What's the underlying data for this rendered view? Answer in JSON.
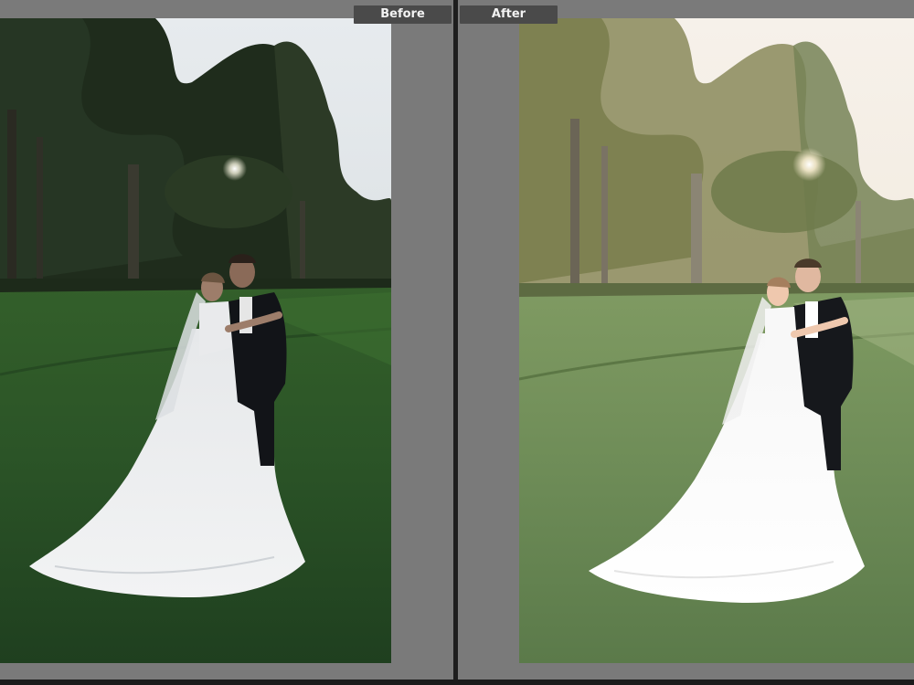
{
  "comparison": {
    "before_label": "Before",
    "after_label": "After"
  },
  "colors": {
    "pane_bg": "#7a7a7a",
    "tab_bg": "#4a4a4a",
    "tab_text": "#f2f2f2",
    "divider": "#1e1e1e"
  },
  "images": {
    "before_alt": "couple-photo-before-edit",
    "after_alt": "couple-photo-after-edit"
  }
}
